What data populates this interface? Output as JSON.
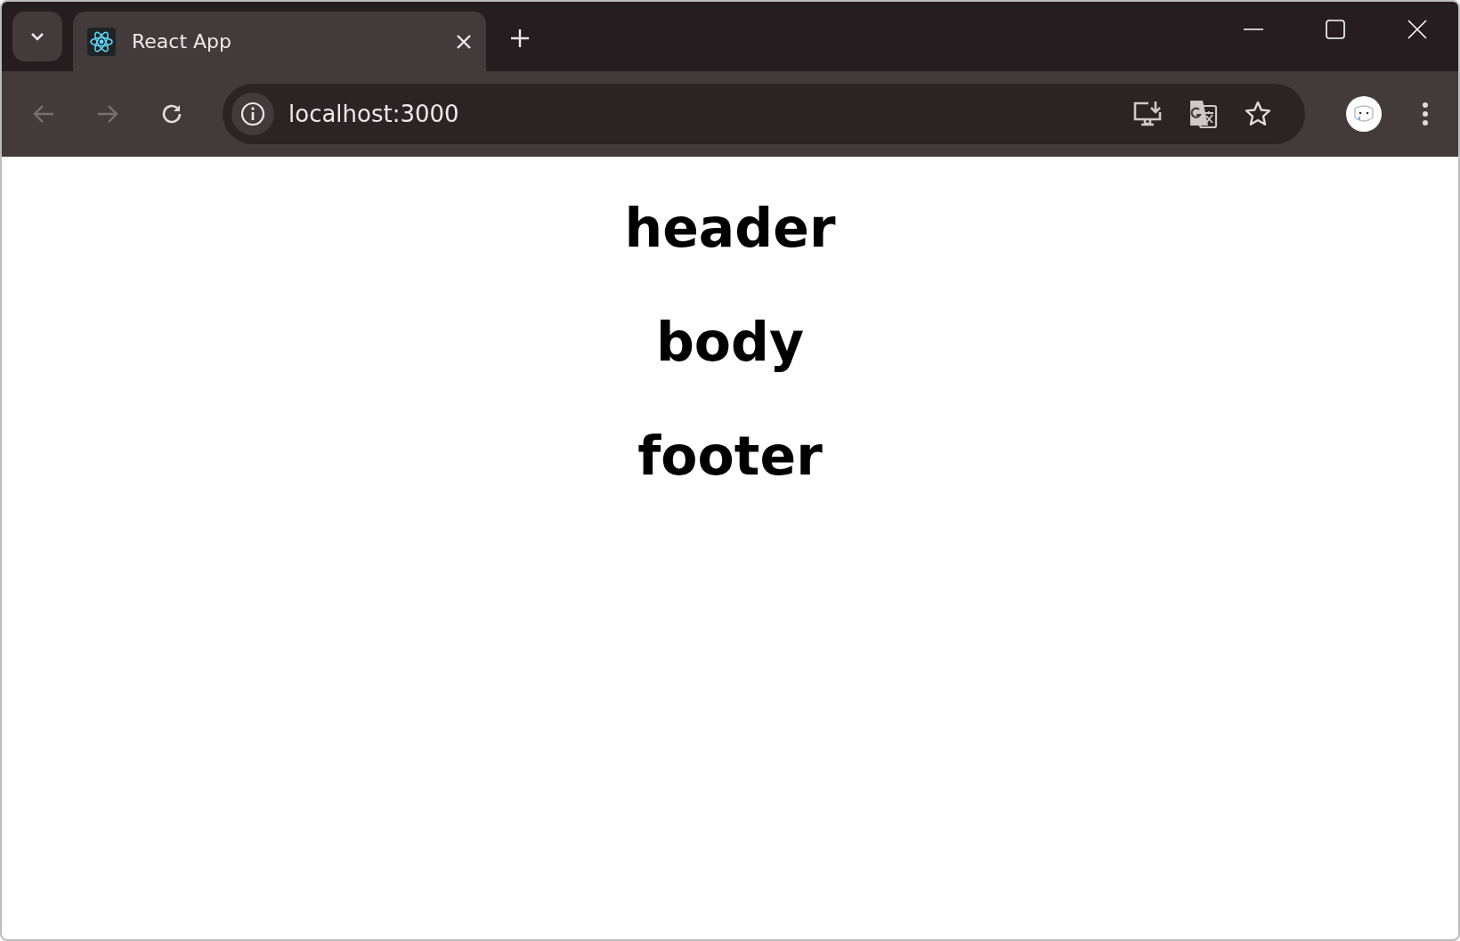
{
  "tabs": [
    {
      "title": "React App",
      "selected": true
    }
  ],
  "toolbar": {
    "back_disabled": true,
    "forward_disabled": true,
    "address": "localhost:3000",
    "bookmarked": false
  },
  "page": {
    "headings": [
      "header",
      "body",
      "footer"
    ]
  }
}
